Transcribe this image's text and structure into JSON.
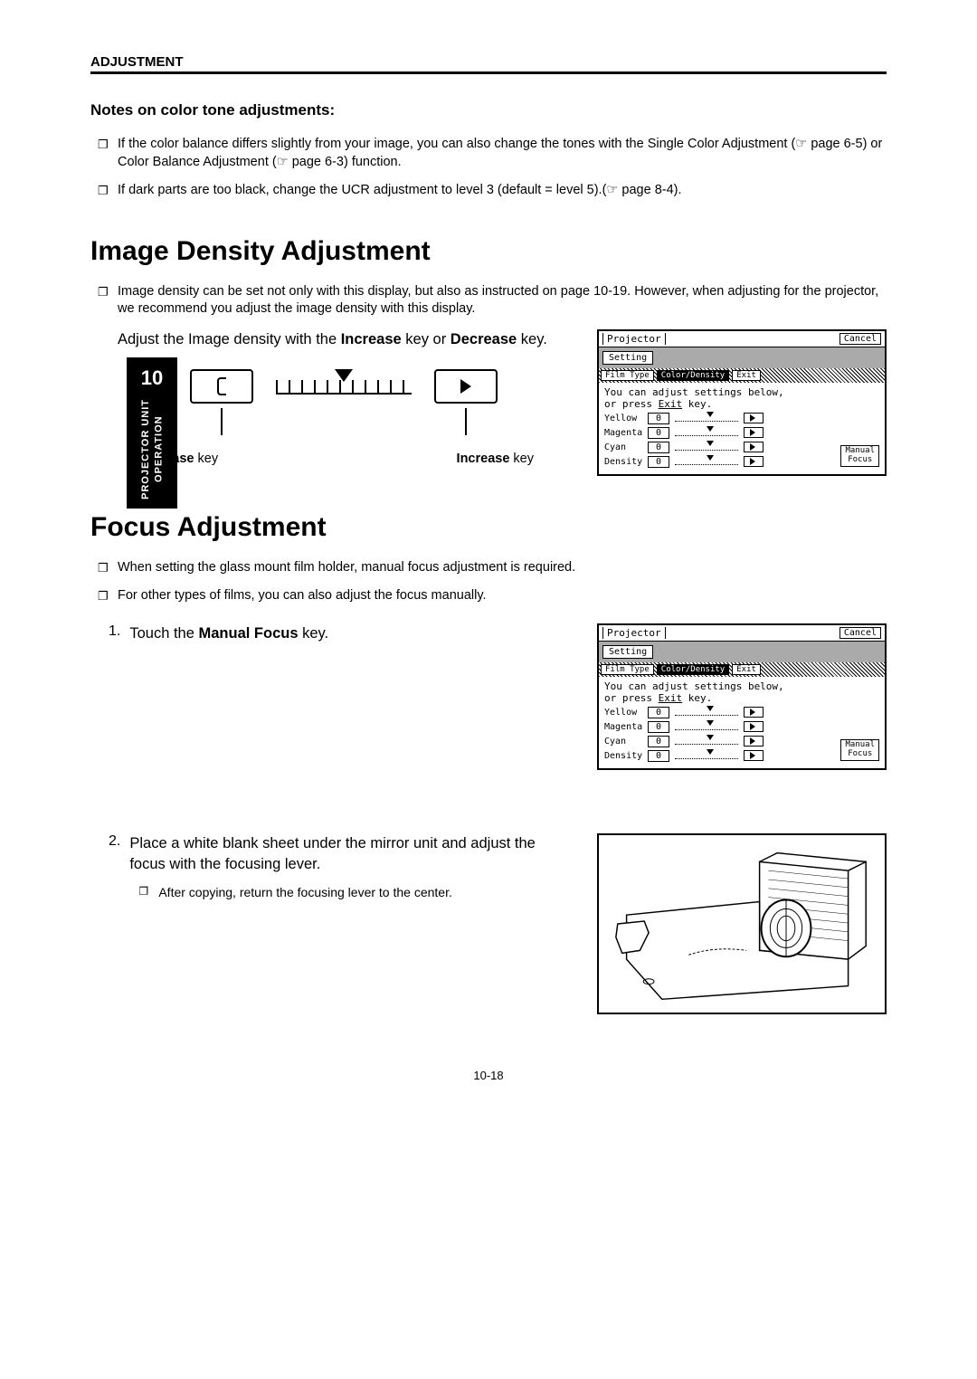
{
  "header": "ADJUSTMENT",
  "notes_title": "Notes on color tone adjustments:",
  "notes": [
    "If the color balance differs slightly from your image, you can also change the tones with the Single Color Adjustment (☞ page 6-5) or Color Balance Adjustment (☞ page 6-3) function.",
    "If dark parts are too black, change the UCR adjustment to level 3 (default = level 5).(☞ page 8-4)."
  ],
  "section1": {
    "title": "Image Density Adjustment",
    "bullets": [
      "Image density can be set not only with this display, but also as instructed on page 10-19. However, when adjusting for the projector, we recommend you adjust the image density with this display."
    ],
    "instruction_pre": "Adjust the Image density with the ",
    "instruction_bold1": "Increase",
    "instruction_mid": " key or ",
    "instruction_bold2": "Decrease",
    "instruction_post": " key.",
    "decrease_label_bold": "Decrease",
    "decrease_label_post": " key",
    "increase_label_bold": "Increase",
    "increase_label_post": " key"
  },
  "sidebar": {
    "num": "10",
    "label_line1": "PROJECTOR UNIT",
    "label_line2": "OPERATION"
  },
  "screenshot": {
    "title": "Projector",
    "cancel": "Cancel",
    "setting": "Setting",
    "tabs": [
      "Film Type",
      "Color/Density",
      "Exit"
    ],
    "body_text1": "You can adjust settings below,",
    "body_text2": "or press ",
    "body_exit": "Exit",
    "body_text3": " key.",
    "rows": [
      {
        "label": "Yellow",
        "val": "0"
      },
      {
        "label": "Magenta",
        "val": "0"
      },
      {
        "label": "Cyan",
        "val": "0"
      },
      {
        "label": "Density",
        "val": "0"
      }
    ],
    "focus_btn_line1": "Manual",
    "focus_btn_line2": "Focus"
  },
  "section2": {
    "title": "Focus Adjustment",
    "bullets": [
      "When setting the glass mount film holder, manual focus adjustment is required.",
      "For other types of films, you can also adjust the focus manually."
    ],
    "step1_num": "1.",
    "step1_pre": "Touch the ",
    "step1_bold": "Manual Focus",
    "step1_post": " key.",
    "step2_num": "2.",
    "step2_text": "Place a white blank sheet under the mirror unit and adjust the focus with the focusing lever.",
    "step2_sub": "After copying, return the focusing lever to the center."
  },
  "page_num": "10-18"
}
